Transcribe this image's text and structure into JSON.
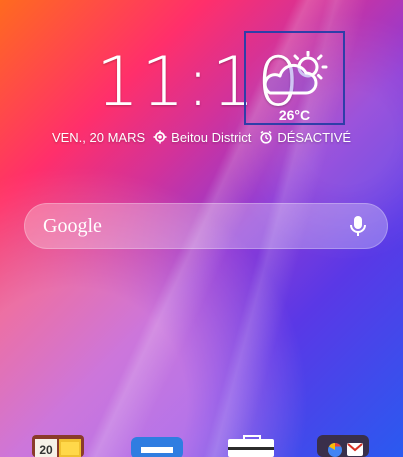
{
  "homescreen": {
    "time": "11:10",
    "weather": {
      "temperature": "26°C",
      "icon": "partly-cloudy-icon"
    },
    "status": {
      "date": "VEN., 20 MARS",
      "location": "Beitou District",
      "alarm": "DÉSACTIVÉ",
      "location_icon": "location-target-icon",
      "alarm_icon": "alarm-clock-icon"
    },
    "search": {
      "label": "Google",
      "mic_icon": "microphone-icon"
    },
    "dock": [
      {
        "name": "calendar",
        "text": "20",
        "icon": "calendar-icon"
      },
      {
        "name": "mail",
        "icon": "mail-icon"
      },
      {
        "name": "play-store",
        "icon": "play-store-icon"
      },
      {
        "name": "google-apps-folder",
        "icon": "apps-folder-icon"
      }
    ]
  },
  "colors": {
    "weather_highlight_border": "#2f3ea8",
    "text": "#ffffff"
  }
}
